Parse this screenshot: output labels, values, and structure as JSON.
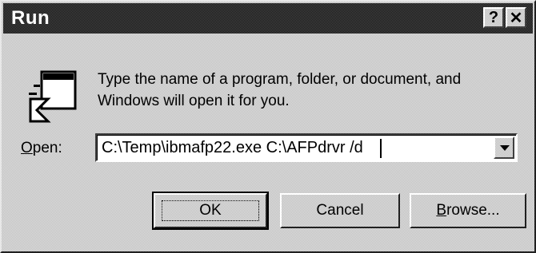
{
  "window": {
    "title": "Run",
    "help_button": "?",
    "close_button": "✕"
  },
  "prompt": {
    "line1": "Type the name of a program, folder, or document, and",
    "line2": "Windows will open it for you."
  },
  "open": {
    "label_first": "O",
    "label_rest": "pen:",
    "value": "C:\\Temp\\ibmafp22.exe C:\\AFPdrvr /d"
  },
  "buttons": {
    "ok": "OK",
    "cancel": "Cancel",
    "browse_first": "B",
    "browse_rest": "rowse..."
  },
  "icons": {
    "run": "run-icon",
    "dropdown": "chevron-down-icon"
  }
}
